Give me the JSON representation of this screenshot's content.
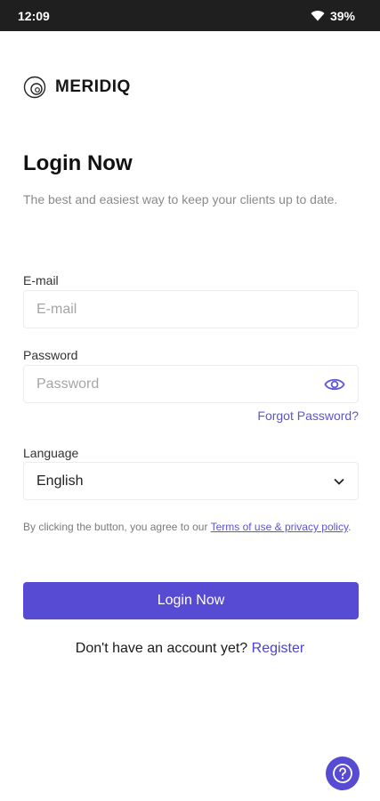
{
  "status_bar": {
    "time": "12:09",
    "battery": "39%"
  },
  "brand": {
    "name": "MERIDIQ"
  },
  "header": {
    "title": "Login Now",
    "subtitle": "The best and easiest way to keep your clients up to date."
  },
  "form": {
    "email": {
      "label": "E-mail",
      "placeholder": "E-mail",
      "value": ""
    },
    "password": {
      "label": "Password",
      "placeholder": "Password",
      "value": ""
    },
    "forgot_password": "Forgot Password?",
    "language": {
      "label": "Language",
      "selected": "English"
    }
  },
  "terms": {
    "prefix": "By clicking the button, you agree to our ",
    "link": "Terms of use & privacy policy",
    "suffix": "."
  },
  "login_button": "Login Now",
  "register": {
    "prompt": "Don't have an account yet? ",
    "link": "Register"
  },
  "colors": {
    "accent": "#574bd3",
    "link": "#5b54d6",
    "status_bar_bg": "#1f1f1f"
  },
  "icons": {
    "wifi": "wifi-icon",
    "battery": "battery-icon",
    "logo": "meridiq-logo-mark",
    "eye": "eye-icon",
    "chevron": "chevron-down-icon",
    "help": "question-mark-icon"
  }
}
